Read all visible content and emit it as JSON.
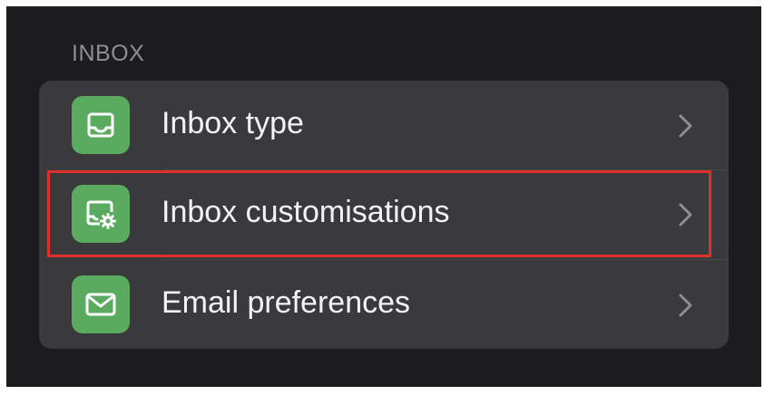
{
  "section": {
    "title": "INBOX"
  },
  "items": [
    {
      "label": "Inbox type",
      "icon": "inbox-tray-icon"
    },
    {
      "label": "Inbox customisations",
      "icon": "inbox-settings-icon"
    },
    {
      "label": "Email preferences",
      "icon": "envelope-icon"
    }
  ],
  "colors": {
    "background": "#1c1c1e",
    "group": "#3a3a3c",
    "icon_tile": "#5aaa5f",
    "label": "#f2f2f7",
    "section_header": "#8e8e93",
    "chevron": "#8e8e93",
    "highlight": "#e0302c"
  }
}
